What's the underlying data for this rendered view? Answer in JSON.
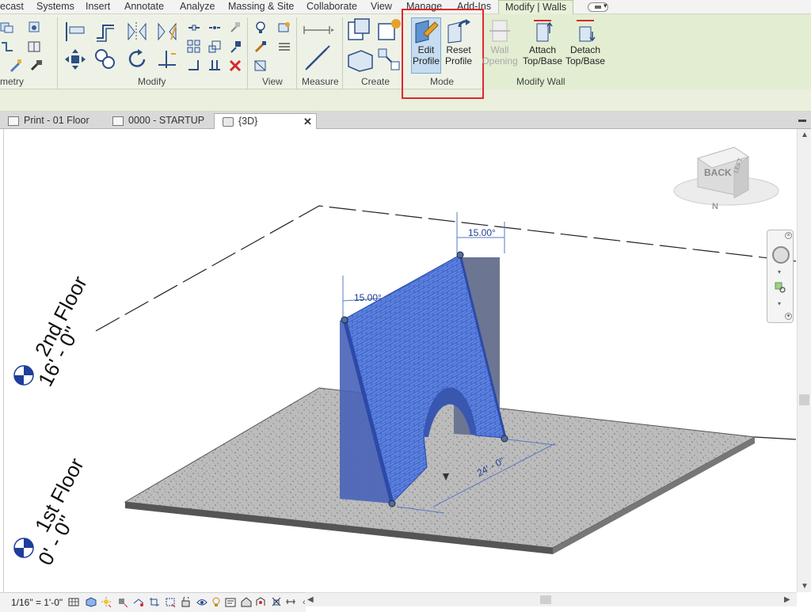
{
  "ribbon_tabs": [
    {
      "label": "ecast"
    },
    {
      "label": "Systems"
    },
    {
      "label": "Insert"
    },
    {
      "label": "Annotate"
    },
    {
      "label": "Analyze"
    },
    {
      "label": "Massing & Site"
    },
    {
      "label": "Collaborate"
    },
    {
      "label": "View"
    },
    {
      "label": "Manage"
    },
    {
      "label": "Add-Ins"
    },
    {
      "label": "Modify | Walls"
    }
  ],
  "panels": {
    "geometry": "metry",
    "modify": "Modify",
    "view": "View",
    "measure": "Measure",
    "create": "Create",
    "mode": "Mode",
    "modify_wall": "Modify Wall"
  },
  "mode_buttons": {
    "edit_profile": [
      "Edit",
      "Profile"
    ],
    "reset_profile": [
      "Reset",
      "Profile"
    ]
  },
  "modify_wall_buttons": {
    "wall_opening": [
      "Wall",
      "Opening"
    ],
    "attach": [
      "Attach",
      "Top/Base"
    ],
    "detach": [
      "Detach",
      "Top/Base"
    ]
  },
  "view_tabs": [
    {
      "label": "Print - 01 Floor"
    },
    {
      "label": "0000 - STARTUP"
    },
    {
      "label": "{3D}",
      "close": "✕"
    }
  ],
  "viewcube": {
    "face": "BACK",
    "side": "LEFT",
    "compass": "N"
  },
  "levels": [
    {
      "name": "2nd Floor",
      "elevation": "16' - 0\""
    },
    {
      "name": "1st Floor",
      "elevation": "0' - 0\""
    }
  ],
  "dimensions": {
    "angle_top": "15.00°",
    "angle_left": "15.00°",
    "length": "24' - 0\""
  },
  "status": {
    "scale": "1/16\" = 1'-0\""
  },
  "colors": {
    "ribbon_bg": "#eef2e6",
    "contextual_tab": "#e3edd2",
    "wall_selected": "#4a6fd8",
    "highlight": "#e0272c"
  }
}
